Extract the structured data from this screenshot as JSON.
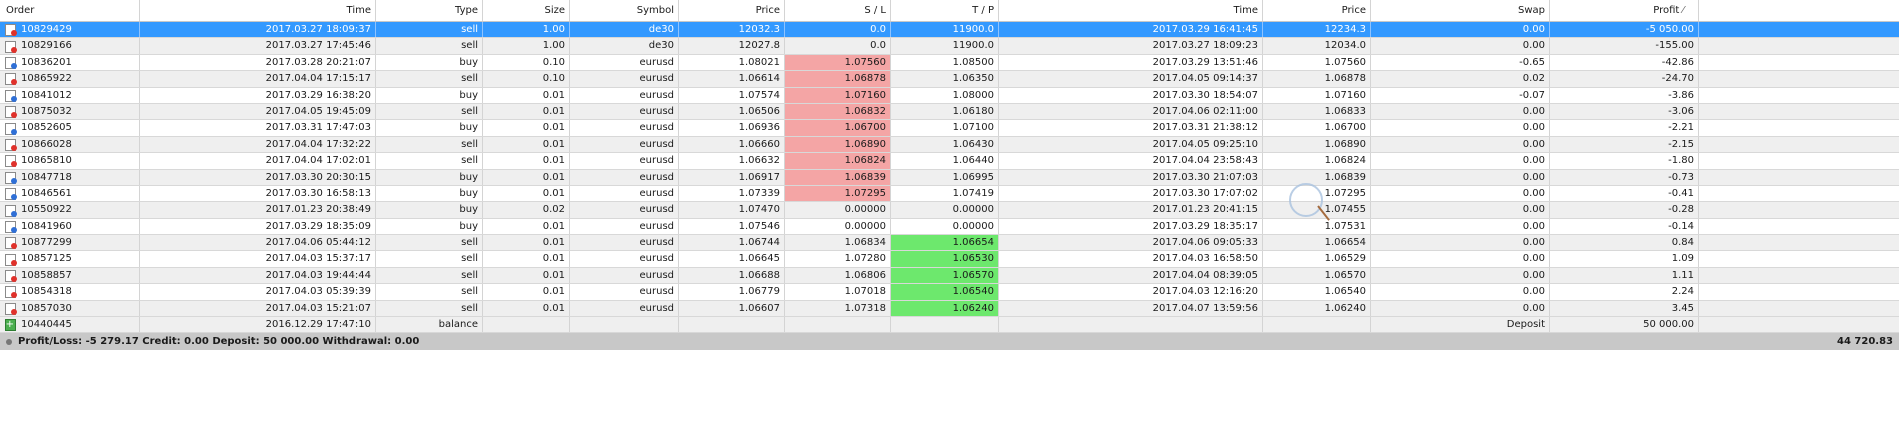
{
  "headers": {
    "order": "Order",
    "time": "Time",
    "type": "Type",
    "size": "Size",
    "symbol": "Symbol",
    "price": "Price",
    "sl": "S / L",
    "tp": "T / P",
    "close_time": "Time",
    "close_price": "Price",
    "swap": "Swap",
    "profit": "Profit"
  },
  "rows": [
    {
      "order": "10829429",
      "time": "2017.03.27 18:09:37",
      "type": "sell",
      "size": "1.00",
      "symbol": "de30",
      "price": "12032.3",
      "sl": "0.0",
      "tp": "11900.0",
      "close_time": "2017.03.29 16:41:45",
      "close_price": "12234.3",
      "swap": "0.00",
      "profit": "-5 050.00",
      "icon": "sell-order-icon"
    },
    {
      "order": "10829166",
      "time": "2017.03.27 17:45:46",
      "type": "sell",
      "size": "1.00",
      "symbol": "de30",
      "price": "12027.8",
      "sl": "0.0",
      "tp": "11900.0",
      "close_time": "2017.03.27 18:09:23",
      "close_price": "12034.0",
      "swap": "0.00",
      "profit": "-155.00",
      "icon": "sell-order-icon"
    },
    {
      "order": "10836201",
      "time": "2017.03.28 20:21:07",
      "type": "buy",
      "size": "0.10",
      "symbol": "eurusd",
      "price": "1.08021",
      "sl": "1.07560",
      "tp": "1.08500",
      "close_time": "2017.03.29 13:51:46",
      "close_price": "1.07560",
      "swap": "-0.65",
      "profit": "-42.86",
      "icon": "buy-order-icon",
      "sl_hit": true
    },
    {
      "order": "10865922",
      "time": "2017.04.04 17:15:17",
      "type": "sell",
      "size": "0.10",
      "symbol": "eurusd",
      "price": "1.06614",
      "sl": "1.06878",
      "tp": "1.06350",
      "close_time": "2017.04.05 09:14:37",
      "close_price": "1.06878",
      "swap": "0.02",
      "profit": "-24.70",
      "icon": "sell-order-icon",
      "sl_hit": true
    },
    {
      "order": "10841012",
      "time": "2017.03.29 16:38:20",
      "type": "buy",
      "size": "0.01",
      "symbol": "eurusd",
      "price": "1.07574",
      "sl": "1.07160",
      "tp": "1.08000",
      "close_time": "2017.03.30 18:54:07",
      "close_price": "1.07160",
      "swap": "-0.07",
      "profit": "-3.86",
      "icon": "buy-order-icon",
      "sl_hit": true
    },
    {
      "order": "10875032",
      "time": "2017.04.05 19:45:09",
      "type": "sell",
      "size": "0.01",
      "symbol": "eurusd",
      "price": "1.06506",
      "sl": "1.06832",
      "tp": "1.06180",
      "close_time": "2017.04.06 02:11:00",
      "close_price": "1.06833",
      "swap": "0.00",
      "profit": "-3.06",
      "icon": "sell-order-icon",
      "sl_hit": true
    },
    {
      "order": "10852605",
      "time": "2017.03.31 17:47:03",
      "type": "buy",
      "size": "0.01",
      "symbol": "eurusd",
      "price": "1.06936",
      "sl": "1.06700",
      "tp": "1.07100",
      "close_time": "2017.03.31 21:38:12",
      "close_price": "1.06700",
      "swap": "0.00",
      "profit": "-2.21",
      "icon": "buy-order-icon",
      "sl_hit": true
    },
    {
      "order": "10866028",
      "time": "2017.04.04 17:32:22",
      "type": "sell",
      "size": "0.01",
      "symbol": "eurusd",
      "price": "1.06660",
      "sl": "1.06890",
      "tp": "1.06430",
      "close_time": "2017.04.05 09:25:10",
      "close_price": "1.06890",
      "swap": "0.00",
      "profit": "-2.15",
      "icon": "sell-order-icon",
      "sl_hit": true
    },
    {
      "order": "10865810",
      "time": "2017.04.04 17:02:01",
      "type": "sell",
      "size": "0.01",
      "symbol": "eurusd",
      "price": "1.06632",
      "sl": "1.06824",
      "tp": "1.06440",
      "close_time": "2017.04.04 23:58:43",
      "close_price": "1.06824",
      "swap": "0.00",
      "profit": "-1.80",
      "icon": "sell-order-icon",
      "sl_hit": true
    },
    {
      "order": "10847718",
      "time": "2017.03.30 20:30:15",
      "type": "buy",
      "size": "0.01",
      "symbol": "eurusd",
      "price": "1.06917",
      "sl": "1.06839",
      "tp": "1.06995",
      "close_time": "2017.03.30 21:07:03",
      "close_price": "1.06839",
      "swap": "0.00",
      "profit": "-0.73",
      "icon": "buy-order-icon",
      "sl_hit": true
    },
    {
      "order": "10846561",
      "time": "2017.03.30 16:58:13",
      "type": "buy",
      "size": "0.01",
      "symbol": "eurusd",
      "price": "1.07339",
      "sl": "1.07295",
      "tp": "1.07419",
      "close_time": "2017.03.30 17:07:02",
      "close_price": "1.07295",
      "swap": "0.00",
      "profit": "-0.41",
      "icon": "buy-order-icon",
      "sl_hit": true
    },
    {
      "order": "10550922",
      "time": "2017.01.23 20:38:49",
      "type": "buy",
      "size": "0.02",
      "symbol": "eurusd",
      "price": "1.07470",
      "sl": "0.00000",
      "tp": "0.00000",
      "close_time": "2017.01.23 20:41:15",
      "close_price": "1.07455",
      "swap": "0.00",
      "profit": "-0.28",
      "icon": "buy-order-icon"
    },
    {
      "order": "10841960",
      "time": "2017.03.29 18:35:09",
      "type": "buy",
      "size": "0.01",
      "symbol": "eurusd",
      "price": "1.07546",
      "sl": "0.00000",
      "tp": "0.00000",
      "close_time": "2017.03.29 18:35:17",
      "close_price": "1.07531",
      "swap": "0.00",
      "profit": "-0.14",
      "icon": "buy-order-icon"
    },
    {
      "order": "10877299",
      "time": "2017.04.06 05:44:12",
      "type": "sell",
      "size": "0.01",
      "symbol": "eurusd",
      "price": "1.06744",
      "sl": "1.06834",
      "tp": "1.06654",
      "close_time": "2017.04.06 09:05:33",
      "close_price": "1.06654",
      "swap": "0.00",
      "profit": "0.84",
      "icon": "sell-order-icon",
      "tp_hit": true
    },
    {
      "order": "10857125",
      "time": "2017.04.03 15:37:17",
      "type": "sell",
      "size": "0.01",
      "symbol": "eurusd",
      "price": "1.06645",
      "sl": "1.07280",
      "tp": "1.06530",
      "close_time": "2017.04.03 16:58:50",
      "close_price": "1.06529",
      "swap": "0.00",
      "profit": "1.09",
      "icon": "sell-order-icon",
      "tp_hit": true
    },
    {
      "order": "10858857",
      "time": "2017.04.03 19:44:44",
      "type": "sell",
      "size": "0.01",
      "symbol": "eurusd",
      "price": "1.06688",
      "sl": "1.06806",
      "tp": "1.06570",
      "close_time": "2017.04.04 08:39:05",
      "close_price": "1.06570",
      "swap": "0.00",
      "profit": "1.11",
      "icon": "sell-order-icon",
      "tp_hit": true
    },
    {
      "order": "10854318",
      "time": "2017.04.03 05:39:39",
      "type": "sell",
      "size": "0.01",
      "symbol": "eurusd",
      "price": "1.06779",
      "sl": "1.07018",
      "tp": "1.06540",
      "close_time": "2017.04.03 12:16:20",
      "close_price": "1.06540",
      "swap": "0.00",
      "profit": "2.24",
      "icon": "sell-order-icon",
      "tp_hit": true
    },
    {
      "order": "10857030",
      "time": "2017.04.03 15:21:07",
      "type": "sell",
      "size": "0.01",
      "symbol": "eurusd",
      "price": "1.06607",
      "sl": "1.07318",
      "tp": "1.06240",
      "close_time": "2017.04.07 13:59:56",
      "close_price": "1.06240",
      "swap": "0.00",
      "profit": "3.45",
      "icon": "sell-order-icon",
      "tp_hit": true
    }
  ],
  "balance_row": {
    "order": "10440445",
    "time": "2016.12.29 17:47:10",
    "type": "balance",
    "swap": "Deposit",
    "profit": "50 000.00",
    "icon": "balance-icon"
  },
  "summary": {
    "text": "Profit/Loss: -5 279.17  Credit: 0.00  Deposit: 50 000.00  Withdrawal: 0.00",
    "total": "44 720.83"
  },
  "colors": {
    "selected": "#3399ff",
    "sl_hit": "#f4a5a5",
    "tp_hit": "#6de86d",
    "summary_bg": "#c8c8c8"
  }
}
